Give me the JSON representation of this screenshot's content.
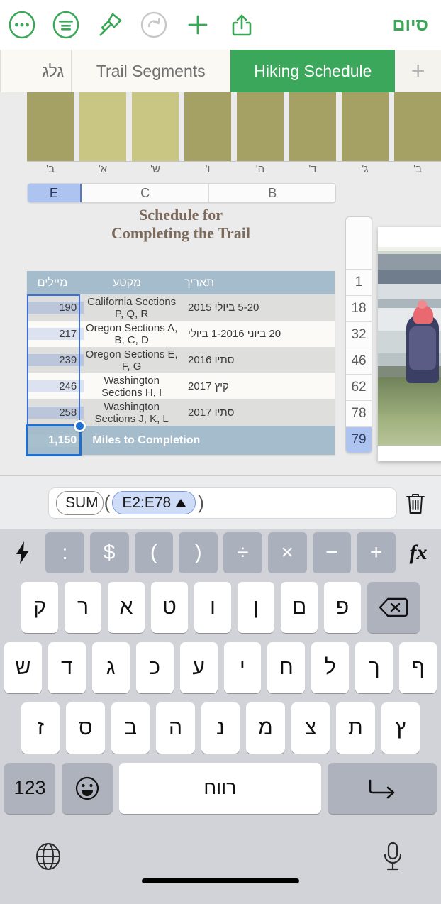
{
  "toolbar": {
    "items": [
      {
        "name": "more-icon",
        "label": "…"
      },
      {
        "name": "format-icon",
        "label": "Format"
      },
      {
        "name": "paintbrush-icon",
        "label": "Paintbrush"
      },
      {
        "name": "redo-icon",
        "label": "Redo"
      },
      {
        "name": "insert-icon",
        "label": "+"
      },
      {
        "name": "share-icon",
        "label": "Share"
      }
    ],
    "done_label": "סיום"
  },
  "tabs": {
    "add_label": "+",
    "items": [
      {
        "label": "Hiking Schedule",
        "active": true
      },
      {
        "label": "Trail Segments",
        "active": false
      },
      {
        "label": "גלג",
        "active": false
      }
    ]
  },
  "chart_data": {
    "type": "bar",
    "title": "",
    "xlabel": "",
    "ylabel": "",
    "grid": false,
    "legend": null,
    "categories": [
      "ב'",
      "ג'",
      "ד'",
      "ה'",
      "ו'",
      "ש'",
      "א'",
      "ב'"
    ],
    "values": [
      100,
      100,
      100,
      100,
      100,
      100,
      100,
      100
    ],
    "colors": [
      "#a5a063",
      "#a5a063",
      "#a5a063",
      "#a5a063",
      "#a5a063",
      "#c9c684",
      "#c9c684",
      "#a5a063"
    ]
  },
  "column_headers": {
    "items": [
      {
        "label": "E",
        "selected": true
      },
      {
        "label": "C",
        "selected": false
      },
      {
        "label": "B",
        "selected": false
      }
    ]
  },
  "table": {
    "title_line1": "Schedule for",
    "title_line2": "Completing the Trail",
    "headers": {
      "date": "תאריך",
      "segment": "מקטע",
      "miles": "מיילים"
    },
    "rows": [
      {
        "date": "5-20 ביולי 2015",
        "segment": "California Sections P, Q, R",
        "miles": "190"
      },
      {
        "date": "20 ביוני 1-2016 ביולי",
        "segment": "Oregon Sections A, B, C, D",
        "miles": "217"
      },
      {
        "date": "סתיו 2016",
        "segment": "Oregon Sections E, F, G",
        "miles": "239"
      },
      {
        "date": "קיץ 2017",
        "segment": "Washington Sections H, I",
        "miles": "246"
      },
      {
        "date": "סתיו 2017",
        "segment": "Washington Sections J, K, L",
        "miles": "258"
      }
    ],
    "total": {
      "label": "Miles to Completion",
      "value": "1,150"
    }
  },
  "row_gutter": {
    "items": [
      {
        "label": "1",
        "selected": false
      },
      {
        "label": "18",
        "selected": false
      },
      {
        "label": "32",
        "selected": false
      },
      {
        "label": "46",
        "selected": false
      },
      {
        "label": "62",
        "selected": false
      },
      {
        "label": "78",
        "selected": false
      },
      {
        "label": "79",
        "selected": true
      }
    ]
  },
  "formula_bar": {
    "function_token": "SUM",
    "open_paren": "(",
    "range_token": "E2:E78",
    "close_paren": ")",
    "delete_name": "trash-icon"
  },
  "keyboard": {
    "symbol_row": {
      "shortcut": "⚡",
      "keys": [
        ":",
        "$",
        "(",
        ")",
        "÷",
        "×",
        "−",
        "+"
      ],
      "function_label": "fx"
    },
    "row1": [
      "ק",
      "ר",
      "א",
      "ט",
      "ו",
      "ן",
      "ם",
      "פ"
    ],
    "backspace": "⌫",
    "row2": [
      "ש",
      "ד",
      "ג",
      "כ",
      "ע",
      "י",
      "ח",
      "ל",
      "ך",
      "ף"
    ],
    "row3": [
      "ז",
      "ס",
      "ב",
      "ה",
      "נ",
      "מ",
      "צ",
      "ת",
      "ץ"
    ],
    "bottom": {
      "numbers": "123",
      "emoji": "emoji-icon",
      "space": "רווח",
      "return": "return-icon"
    },
    "globe": "globe-icon",
    "mic": "microphone-icon"
  },
  "colors": {
    "accent_green": "#3aa757",
    "selection_blue": "#1f6fd0",
    "table_header": "#a4bccc",
    "bar_dark": "#a5a063",
    "bar_light": "#c9c684"
  }
}
